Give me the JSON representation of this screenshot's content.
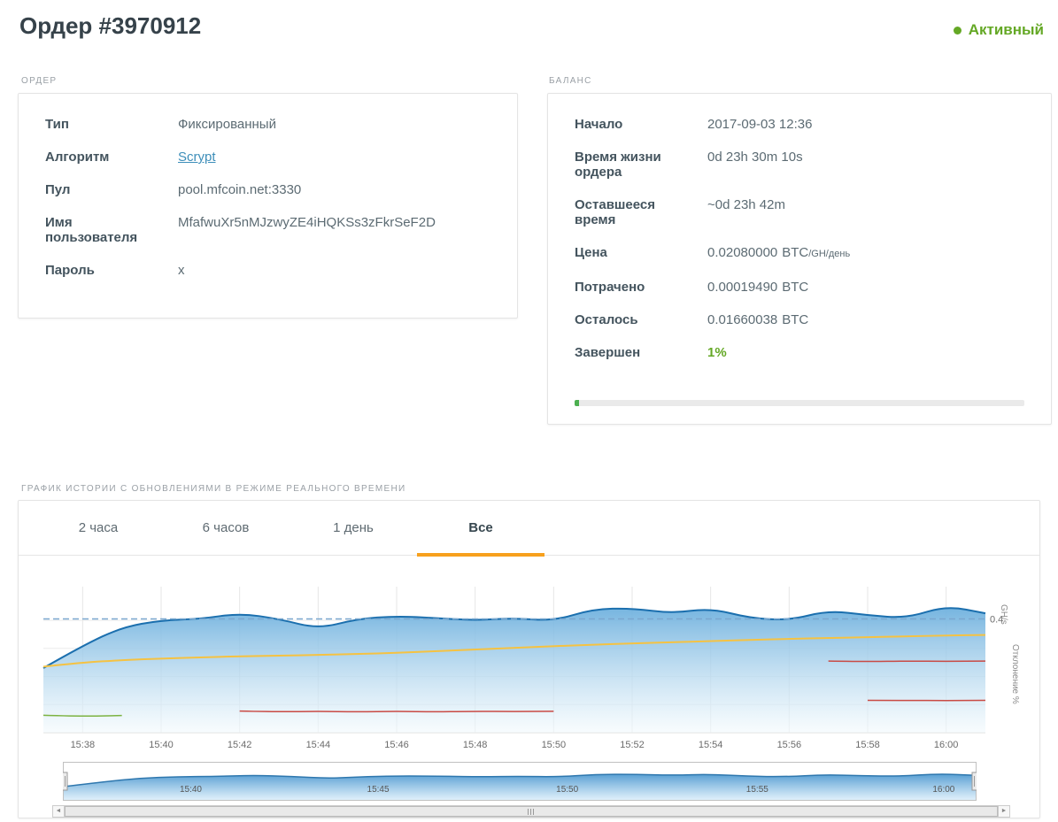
{
  "page": {
    "title": "Ордер #3970912",
    "status_label": "Активный"
  },
  "colors": {
    "status-green": "#64a825",
    "link-blue": "#3d8eb9",
    "accent-orange": "#f7a01d",
    "progress-green": "#4caf50"
  },
  "order_card": {
    "section_label": "ОРДЕР",
    "fields": [
      {
        "label": "Тип",
        "value": "Фиксированный"
      },
      {
        "label": "Алгоритм",
        "value": "Scrypt"
      },
      {
        "label": "Пул",
        "value": "pool.mfcoin.net:3330"
      },
      {
        "label": "Имя пользователя",
        "value": "MfafwuXr5nMJzwyZE4iHQKSs3zFkrSeF2D"
      },
      {
        "label": "Пароль",
        "value": "x"
      }
    ]
  },
  "balance_card": {
    "section_label": "БАЛАНС",
    "fields": [
      {
        "label": "Начало",
        "value": "2017-09-03 12:36",
        "unit": "",
        "unit_small": ""
      },
      {
        "label": "Время жизни ордера",
        "value": "0d 23h 30m 10s",
        "unit": "",
        "unit_small": ""
      },
      {
        "label": "Оставшееся время",
        "value": "~0d 23h 42m",
        "unit": "",
        "unit_small": ""
      },
      {
        "label": "Цена",
        "value": "0.02080000",
        "unit": "BTC",
        "unit_small": "/GH/день"
      },
      {
        "label": "Потрачено",
        "value": "0.00019490",
        "unit": "BTC",
        "unit_small": ""
      },
      {
        "label": "Осталось",
        "value": "0.01660038",
        "unit": "BTC",
        "unit_small": ""
      },
      {
        "label": "Завершен",
        "value": "1%",
        "unit": "",
        "unit_small": ""
      }
    ],
    "progress_percent": 1
  },
  "chart_section": {
    "section_label": "ГРАФИК ИСТОРИИ С ОБНОВЛЕНИЯМИ В РЕЖИМЕ РЕАЛЬНОГО ВРЕМЕНИ",
    "tabs": [
      {
        "label": "2 часа",
        "active": false
      },
      {
        "label": "6 часов",
        "active": false
      },
      {
        "label": "1 день",
        "active": false
      },
      {
        "label": "Все",
        "active": true
      }
    ]
  },
  "scrollbar": {
    "left_arrow": "◄",
    "right_arrow": "►"
  },
  "chart_data": {
    "type": "area",
    "x_labels": [
      "15:38",
      "15:40",
      "15:42",
      "15:44",
      "15:46",
      "15:48",
      "15:50",
      "15:52",
      "15:54",
      "15:56",
      "15:58",
      "16:00"
    ],
    "x_tick_indices": [
      1,
      3,
      5,
      7,
      9,
      11,
      13,
      15,
      17,
      19,
      21,
      23
    ],
    "ylim": [
      0,
      0.52
    ],
    "y_gridlines": [
      0.1,
      0.2,
      0.3,
      0.4
    ],
    "limit_line": {
      "value": 0.405,
      "label": "0.4"
    },
    "right_axis_labels": [
      "GH/s",
      "Отклонение %"
    ],
    "series": [
      {
        "type": "area",
        "color": "#1b6fae",
        "width": 2,
        "values": [
          0.23,
          0.31,
          0.375,
          0.4,
          0.405,
          0.425,
          0.405,
          0.37,
          0.405,
          0.415,
          0.408,
          0.4,
          0.408,
          0.398,
          0.44,
          0.443,
          0.425,
          0.443,
          0.408,
          0.4,
          0.435,
          0.418,
          0.408,
          0.452,
          0.425
        ]
      },
      {
        "type": "line",
        "color": "#f5c242",
        "width": 2,
        "values": [
          0.235,
          0.25,
          0.258,
          0.264,
          0.268,
          0.272,
          0.274,
          0.277,
          0.28,
          0.284,
          0.29,
          0.296,
          0.302,
          0.308,
          0.313,
          0.318,
          0.322,
          0.326,
          0.33,
          0.334,
          0.337,
          0.34,
          0.343,
          0.346,
          0.348
        ]
      },
      {
        "type": "line",
        "color": "#c94a44",
        "width": 1.5,
        "values": [
          null,
          null,
          null,
          null,
          null,
          0.077,
          0.074,
          0.076,
          0.074,
          0.076,
          0.074,
          0.076,
          0.075,
          0.076,
          null,
          null,
          null,
          null,
          null,
          null,
          null,
          null,
          null,
          null,
          null
        ]
      },
      {
        "type": "line",
        "color": "#c94a44",
        "width": 1.5,
        "values": [
          null,
          null,
          null,
          null,
          null,
          null,
          null,
          null,
          null,
          null,
          null,
          null,
          null,
          null,
          null,
          null,
          null,
          null,
          null,
          null,
          0.255,
          0.253,
          0.255,
          0.254,
          0.255
        ]
      },
      {
        "type": "line",
        "color": "#c94a44",
        "width": 1.5,
        "values": [
          null,
          null,
          null,
          null,
          null,
          null,
          null,
          null,
          null,
          null,
          null,
          null,
          null,
          null,
          null,
          null,
          null,
          null,
          null,
          null,
          null,
          0.115,
          0.115,
          0.114,
          0.115
        ]
      },
      {
        "type": "line",
        "color": "#7cb342",
        "width": 1.5,
        "values": [
          0.062,
          0.058,
          0.061,
          null,
          null,
          null,
          null,
          null,
          null,
          null,
          null,
          null,
          null,
          null,
          null,
          null,
          null,
          null,
          null,
          null,
          null,
          null,
          null,
          null,
          null
        ]
      }
    ],
    "navigator": {
      "labels": [
        {
          "text": "15:40",
          "pos": 0.14
        },
        {
          "text": "15:45",
          "pos": 0.345
        },
        {
          "text": "15:50",
          "pos": 0.552
        },
        {
          "text": "15:55",
          "pos": 0.76
        },
        {
          "text": "16:00",
          "pos": 0.964
        }
      ]
    }
  }
}
